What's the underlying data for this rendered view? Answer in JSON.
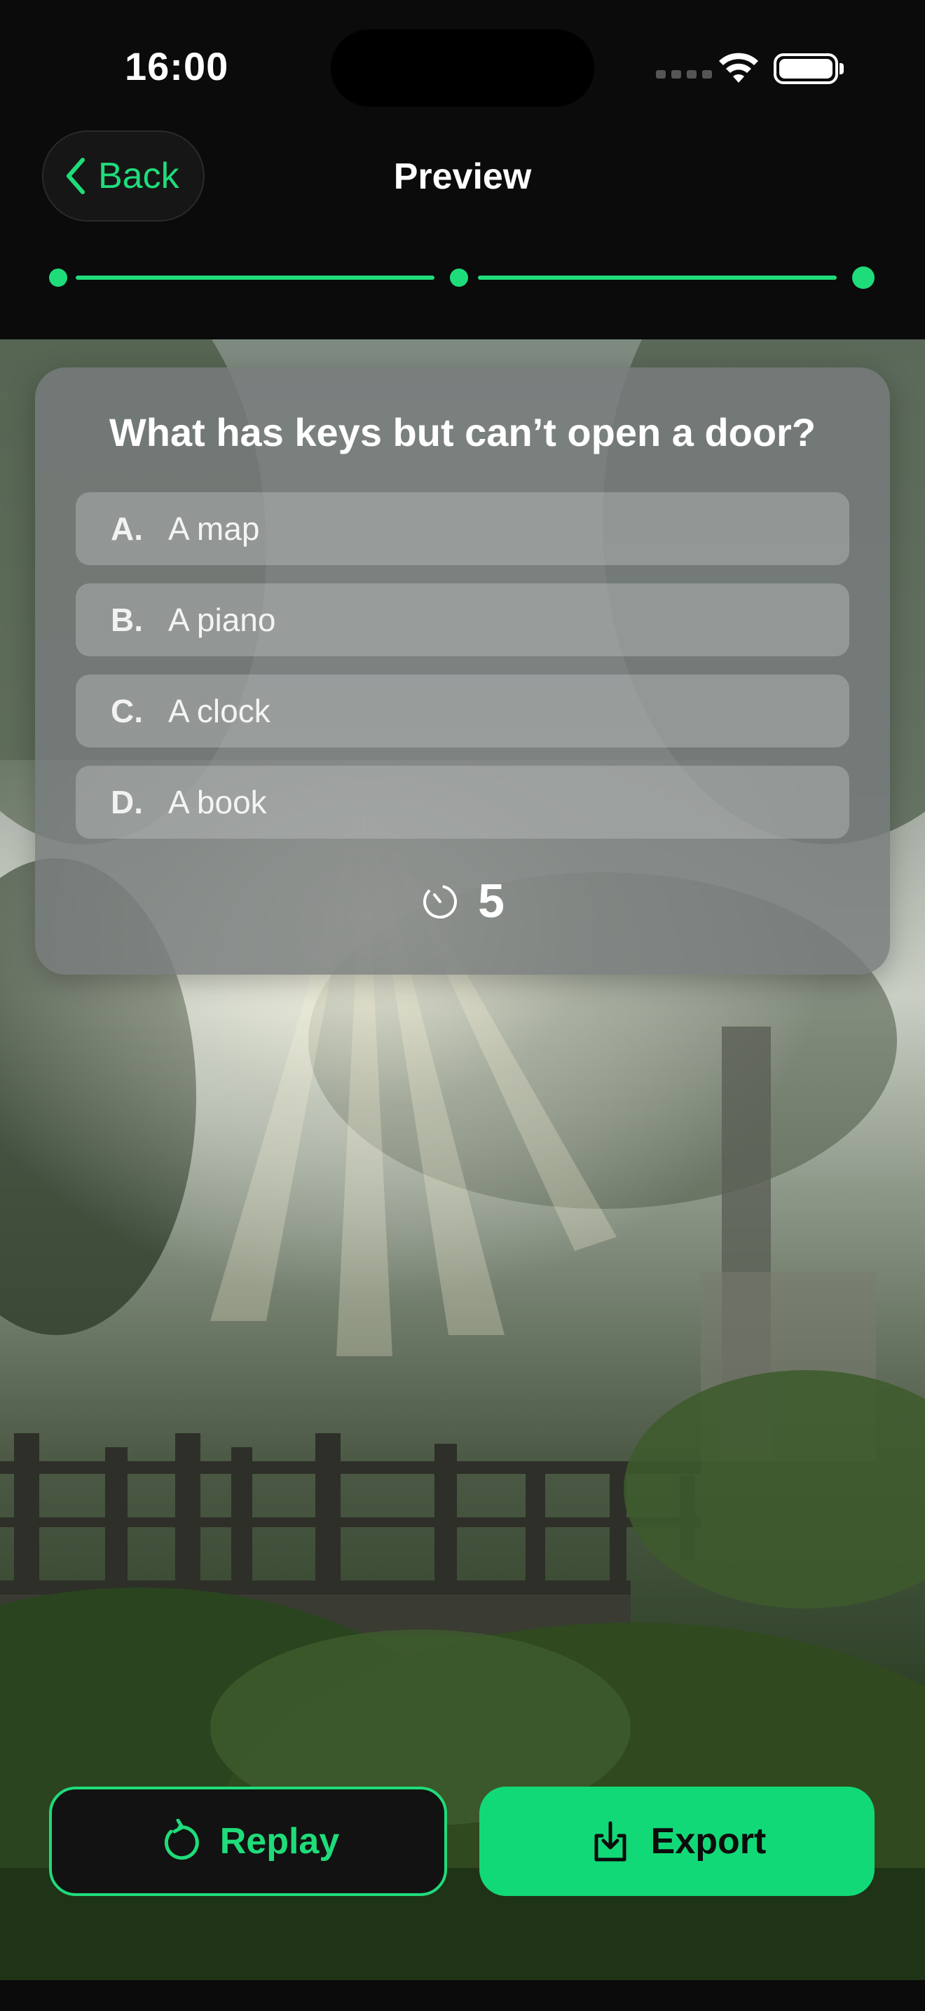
{
  "status_bar": {
    "time": "16:00",
    "icons": [
      "signal-icon",
      "wifi-icon",
      "battery-icon"
    ]
  },
  "header": {
    "back_label": "Back",
    "title": "Preview"
  },
  "progress": {
    "steps": 3,
    "current_step": 3
  },
  "quiz": {
    "question": "What has keys but can’t open a door?",
    "options": [
      {
        "letter": "A.",
        "text": "A map"
      },
      {
        "letter": "B.",
        "text": "A piano"
      },
      {
        "letter": "C.",
        "text": "A clock"
      },
      {
        "letter": "D.",
        "text": "A book"
      }
    ],
    "timer_icon": "timer-icon",
    "timer_value": "5"
  },
  "actions": {
    "replay_label": "Replay",
    "replay_icon": "replay-icon",
    "export_label": "Export",
    "export_icon": "export-icon"
  },
  "colors": {
    "accent": "#1fdc7a",
    "background": "#0b0b0b",
    "export_fill": "#12d977"
  }
}
